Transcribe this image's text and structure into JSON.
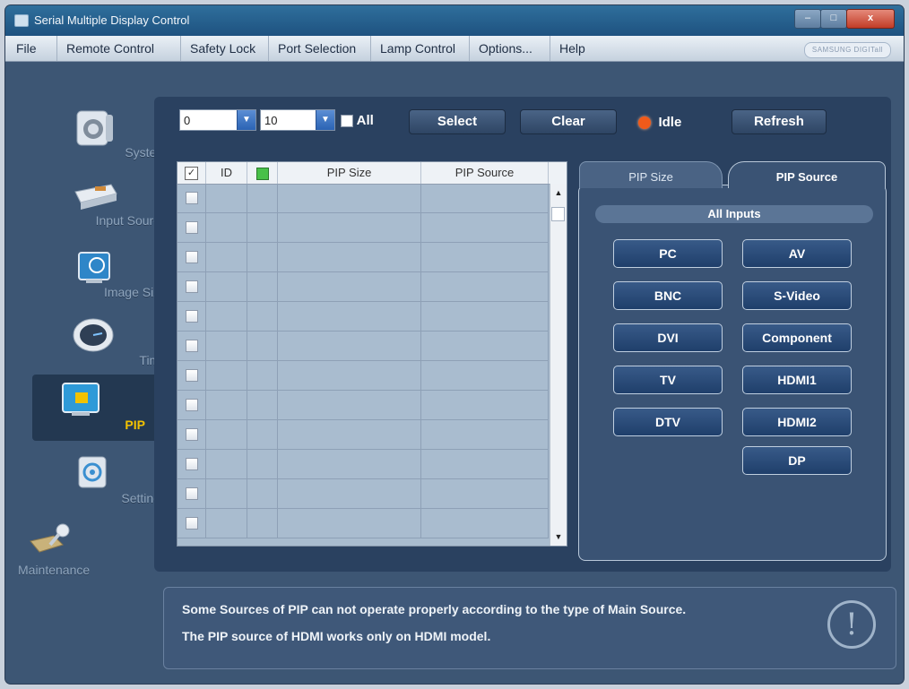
{
  "window": {
    "title": "Serial Multiple Display Control",
    "controls": {
      "minimize": "–",
      "maximize": "□",
      "close": "x"
    }
  },
  "menu": {
    "items": [
      "File",
      "Remote Control",
      "Safety Lock",
      "Port Selection",
      "Lamp Control",
      "Options...",
      "Help"
    ],
    "brand": "SAMSUNG DIGITall"
  },
  "sidebar": {
    "items": [
      {
        "label": "System",
        "icon": "system-icon"
      },
      {
        "label": "Input Source",
        "icon": "input-source-icon"
      },
      {
        "label": "Image Size",
        "icon": "image-size-icon"
      },
      {
        "label": "Time",
        "icon": "clock-icon"
      },
      {
        "label": "PIP",
        "icon": "pip-icon",
        "active": true
      },
      {
        "label": "Settings",
        "icon": "settings-icon"
      },
      {
        "label": "Maintenance",
        "icon": "maintenance-icon"
      }
    ]
  },
  "toolbar": {
    "from_value": "0",
    "to_value": "10",
    "all_label": "All",
    "select_label": "Select",
    "clear_label": "Clear",
    "status_text": "Idle",
    "status_color": "#f05a1a",
    "refresh_label": "Refresh"
  },
  "table": {
    "columns": [
      "ID",
      "PIP Size",
      "PIP Source"
    ],
    "row_count": 12
  },
  "tabs": {
    "pip_size": "PIP Size",
    "pip_source": "PIP Source"
  },
  "sources": {
    "header": "All Inputs",
    "left": [
      "PC",
      "BNC",
      "DVI",
      "TV",
      "DTV"
    ],
    "right": [
      "AV",
      "S-Video",
      "Component",
      "HDMI1",
      "HDMI2",
      "DP"
    ]
  },
  "note": {
    "line1": "Some Sources of PIP can not operate properly according to the type of Main Source.",
    "line2": "The PIP source of HDMI works only on HDMI model.",
    "icon": "warning-icon"
  },
  "colors": {
    "accent_active": "#f2c200",
    "panel": "#2a4160",
    "window_bg": "#3d5674"
  }
}
